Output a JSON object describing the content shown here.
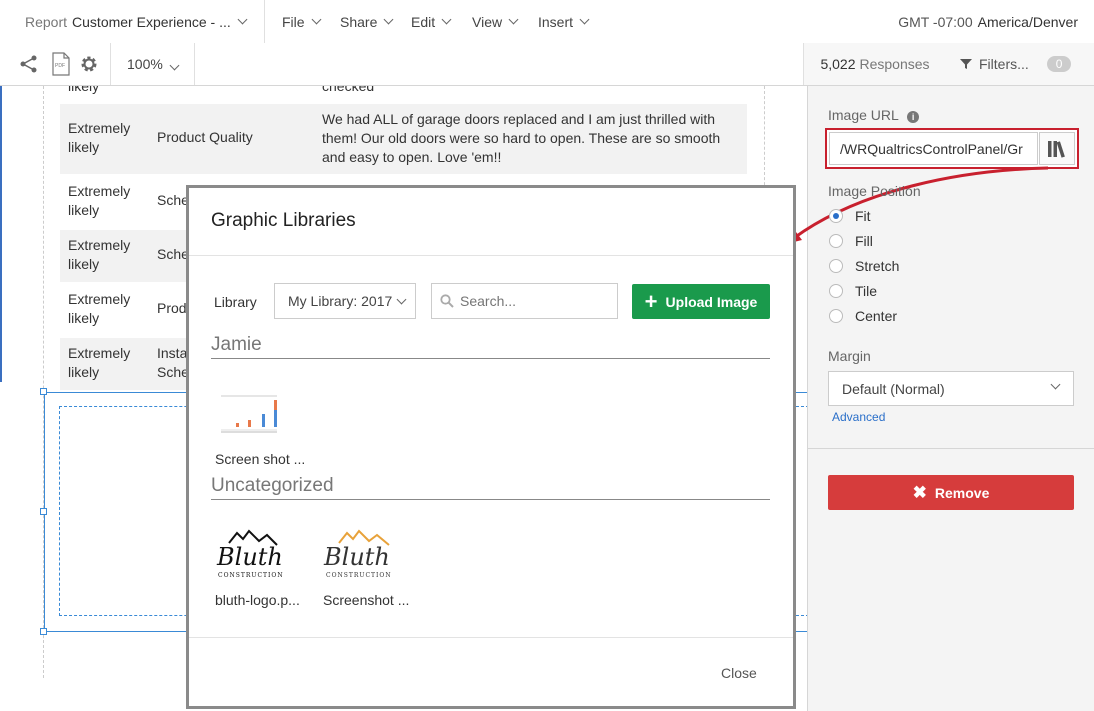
{
  "header": {
    "report_prefix": "Report",
    "report_name": "Customer Experience - ...",
    "menus": [
      "File",
      "Share",
      "Edit",
      "View",
      "Insert"
    ],
    "timezone_offset": "GMT -07:00",
    "timezone_name": "America/Denver"
  },
  "toolbar": {
    "zoom": "100%",
    "response_count": "5,022",
    "responses_label": "Responses",
    "filters_label": "Filters...",
    "filter_count": "0"
  },
  "table": {
    "rows": [
      {
        "likelihood": "likely",
        "category": "",
        "comment": "checked"
      },
      {
        "likelihood": "Extremely likely",
        "category": "Product Quality",
        "comment": "We had ALL of garage doors replaced and I am just thrilled with them! Our old doors were so hard to open. These are so smooth and easy to open. Love 'em!!"
      },
      {
        "likelihood": "Extremely likely",
        "category": "Sche",
        "comment": ""
      },
      {
        "likelihood": "Extremely likely",
        "category": "Sche",
        "comment": ""
      },
      {
        "likelihood": "Extremely likely",
        "category": "Prod",
        "comment": ""
      },
      {
        "likelihood": "Extremely likely",
        "category": "Insta Sche",
        "comment": ""
      }
    ]
  },
  "panel": {
    "image_url_label": "Image URL",
    "image_url_value": "/WRQualtricsControlPanel/Gr",
    "image_position_label": "Image Position",
    "positions": [
      "Fit",
      "Fill",
      "Stretch",
      "Tile",
      "Center"
    ],
    "selected_position": "Fit",
    "margin_label": "Margin",
    "margin_value": "Default (Normal)",
    "advanced_link": "Advanced",
    "remove_label": "Remove"
  },
  "modal": {
    "title": "Graphic Libraries",
    "library_label": "Library",
    "library_value": "My Library: 2017",
    "search_placeholder": "Search...",
    "upload_label": "Upload Image",
    "sections": [
      {
        "title": "Jamie",
        "items": [
          {
            "caption": "Screen shot ..."
          }
        ]
      },
      {
        "title": "Uncategorized",
        "items": [
          {
            "caption": "bluth-logo.p..."
          },
          {
            "caption": "Screenshot ..."
          }
        ]
      }
    ],
    "logo_text": "Bluth",
    "logo_sub": "CONSTRUCTION",
    "close_label": "Close"
  },
  "colors": {
    "highlight_red": "#c8202e",
    "upload_green": "#1a9a4c",
    "remove_red": "#d63c3c",
    "link_blue": "#2a6fc9",
    "logo_gold": "#e8a23a"
  }
}
